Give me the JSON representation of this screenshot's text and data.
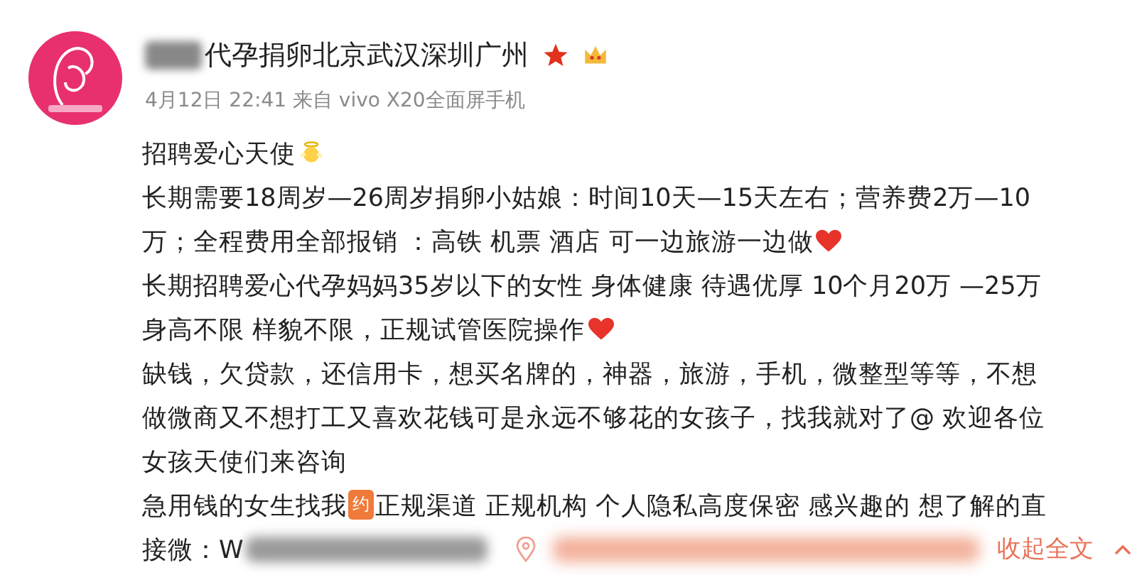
{
  "post": {
    "author": "代孕捐卵北京武汉深圳广州",
    "meta": "4月12日 22:41 来自 vivo X20全面屏手机",
    "lines": [
      {
        "kind": "angel",
        "text": "招聘爱心天使"
      },
      {
        "kind": "text",
        "text": "长期需要18周岁—26周岁捐卵小姑娘：时间10天—15天左右；营养费2万—10"
      },
      {
        "kind": "heart",
        "text": "万；全程费用全部报销 ：高铁 机票 酒店 可一边旅游一边做"
      },
      {
        "kind": "text",
        "text": "长期招聘爱心代孕妈妈35岁以下的女性 身体健康 待遇优厚 10个月20万 —25万"
      },
      {
        "kind": "heart",
        "text": "身高不限 样貌不限，正规试管医院操作"
      },
      {
        "kind": "text",
        "text": "缺钱，欠贷款，还信用卡，想买名牌的，神器，旅游，手机，微整型等等，不想"
      },
      {
        "kind": "text",
        "text": "做微商又不想打工又喜欢花钱可是永远不够花的女孩子，找我就对了@ 欢迎各位"
      },
      {
        "kind": "text",
        "text": "女孩天使们来咨询"
      },
      {
        "kind": "badge",
        "text": "急用钱的女生找我",
        "badge": "约",
        "rest": "正规渠道 正规机构 个人隐私高度保密 感兴趣的 想了解的直"
      },
      {
        "kind": "last",
        "text": "接微：W",
        "collapse": "收起全文"
      }
    ]
  }
}
